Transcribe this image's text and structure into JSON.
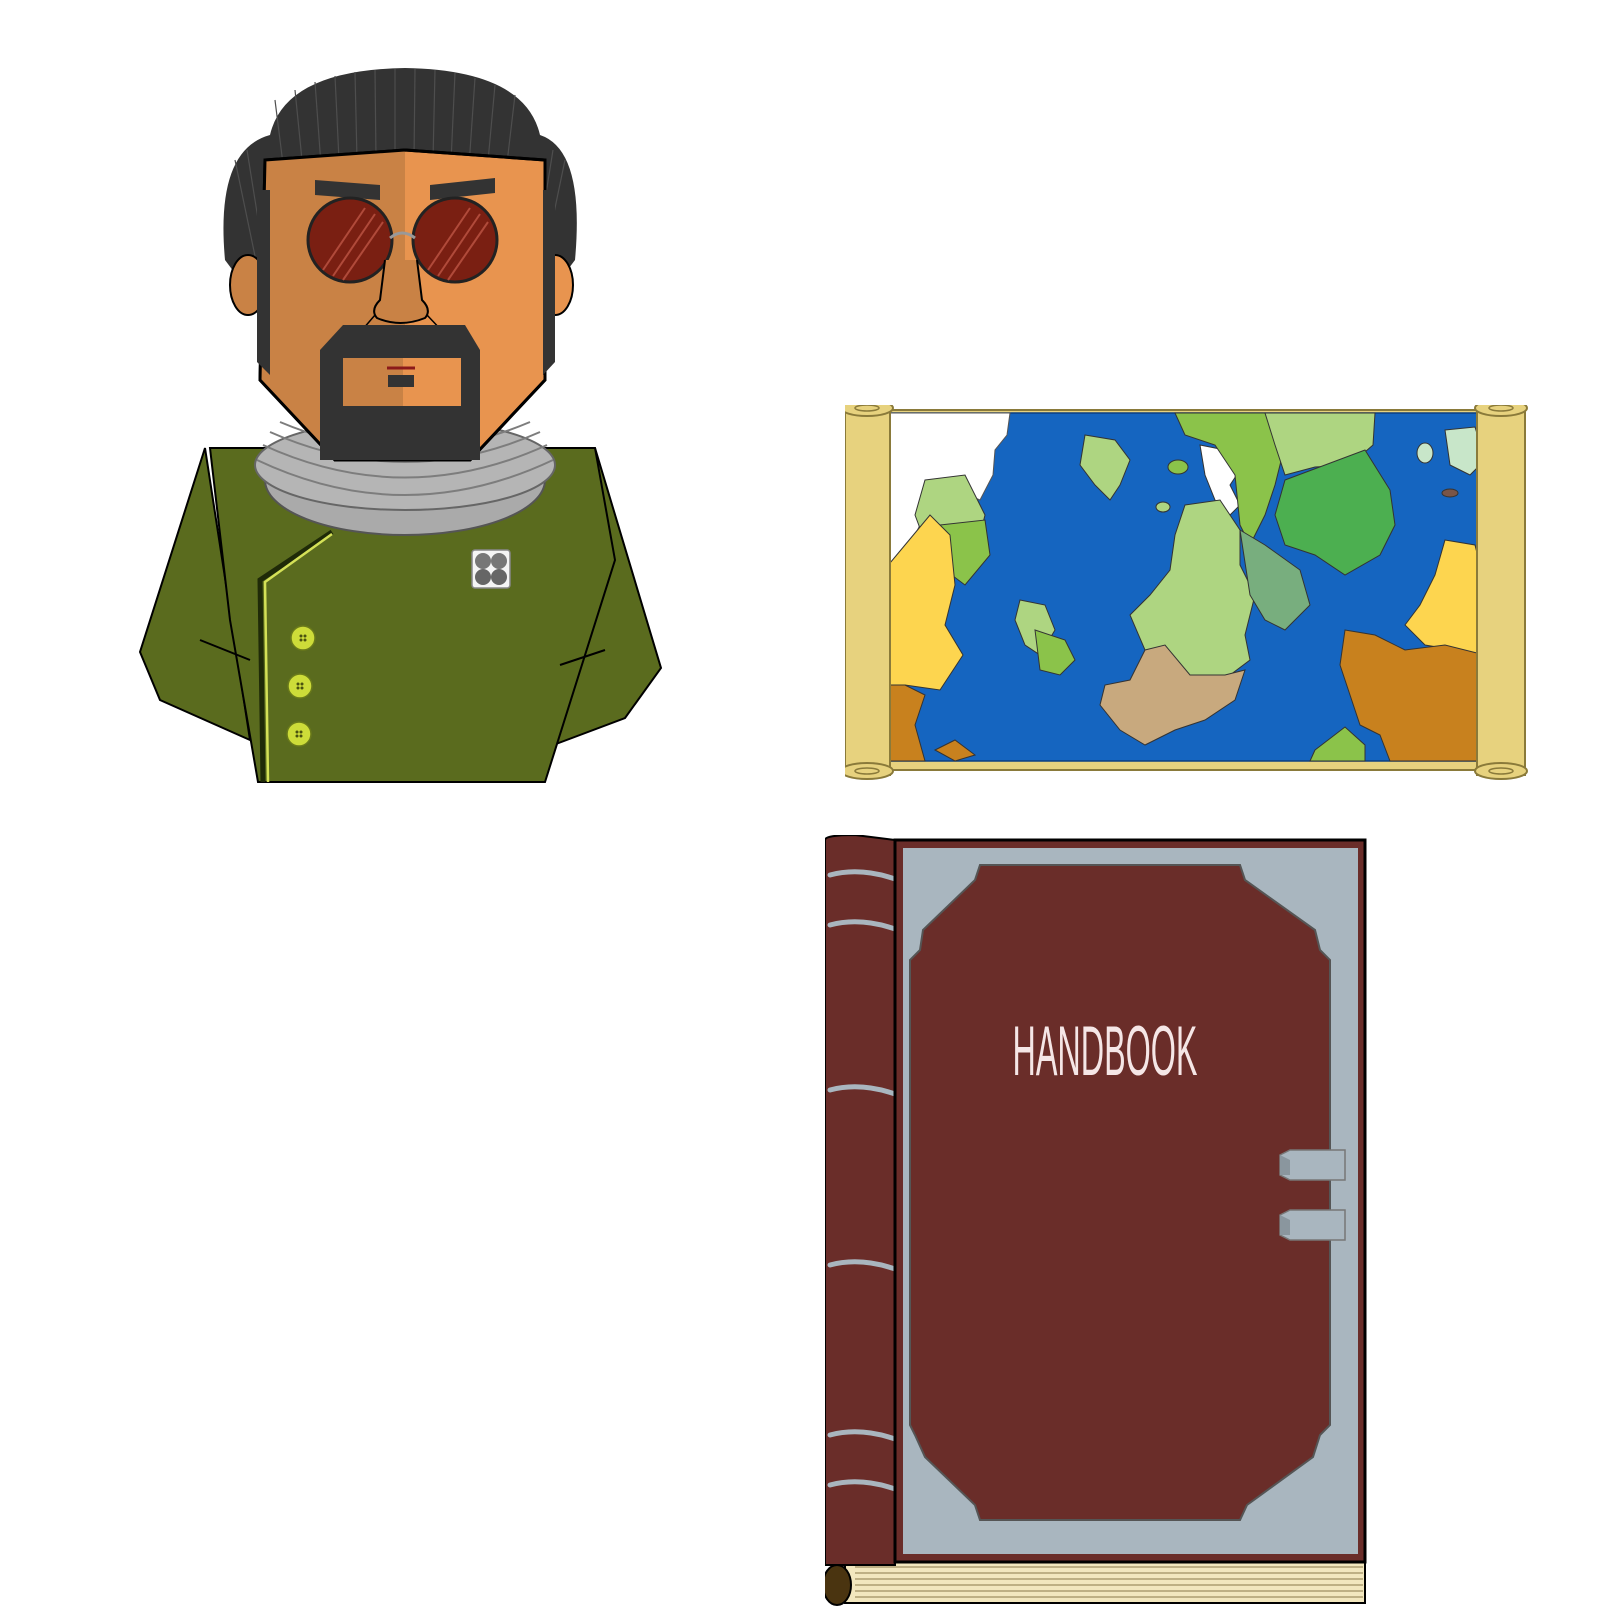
{
  "scene": {
    "items": [
      {
        "id": "character",
        "label": "",
        "icon": "officer-portrait-icon"
      },
      {
        "id": "map",
        "label": "",
        "icon": "world-map-scroll-icon"
      },
      {
        "id": "handbook",
        "label": "HANDBOOK",
        "icon": "book-icon"
      }
    ]
  },
  "colors": {
    "uniform": "#5A6B1E",
    "skin": "#E8944F",
    "skin_shadow": "#C98245",
    "hair": "#333333",
    "ocean": "#1565C0",
    "land_light": "#AED581",
    "land_green": "#4CAF50",
    "land_yellow": "#FDD54F",
    "land_orange": "#C8811E",
    "land_tan": "#C8A97E",
    "scroll_parchment": "#E7D27E",
    "book_cover": "#6A2D29",
    "book_trim": "#A9B6BF",
    "book_pages": "#F2E7BE",
    "button_yellow": "#CDDC39"
  }
}
